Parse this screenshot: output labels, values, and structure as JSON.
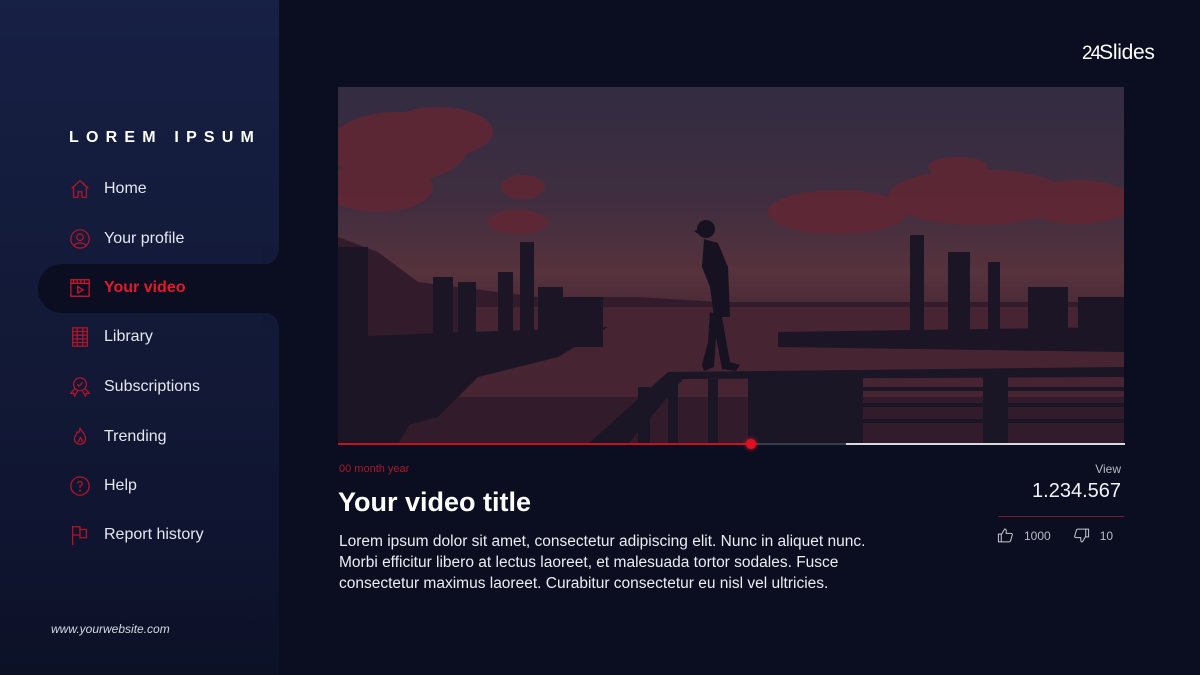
{
  "brand": {
    "logo": "24Slides",
    "logo_num": "24",
    "logo_text": "Slides"
  },
  "sidebar": {
    "heading": "LOREM IPSUM",
    "active_index": 2,
    "accent_color": "#e3192b",
    "items": [
      {
        "label": "Home",
        "icon": "home-icon"
      },
      {
        "label": "Your profile",
        "icon": "profile-icon"
      },
      {
        "label": "Your video",
        "icon": "video-icon"
      },
      {
        "label": "Library",
        "icon": "library-icon"
      },
      {
        "label": "Subscriptions",
        "icon": "subscriptions-icon"
      },
      {
        "label": "Trending",
        "icon": "trending-icon"
      },
      {
        "label": "Help",
        "icon": "help-icon"
      },
      {
        "label": "Report history",
        "icon": "flag-icon"
      }
    ],
    "website": "www.yourwebsite.com"
  },
  "video": {
    "progress": {
      "played_percent": 52.5,
      "buffered_percent": 64.5
    },
    "date": "00 month year",
    "title": "Your video title",
    "description": "Lorem ipsum dolor sit amet, consectetur adipiscing elit. Nunc in aliquet nunc. Morbi efficitur libero at lectus laoreet, et malesuada tortor sodales. Fusce consectetur maximus laoreet. Curabitur consectetur eu nisl vel ultricies."
  },
  "stats": {
    "view_label": "View",
    "view_count": "1.234.567",
    "likes": "1000",
    "dislikes": "10"
  }
}
